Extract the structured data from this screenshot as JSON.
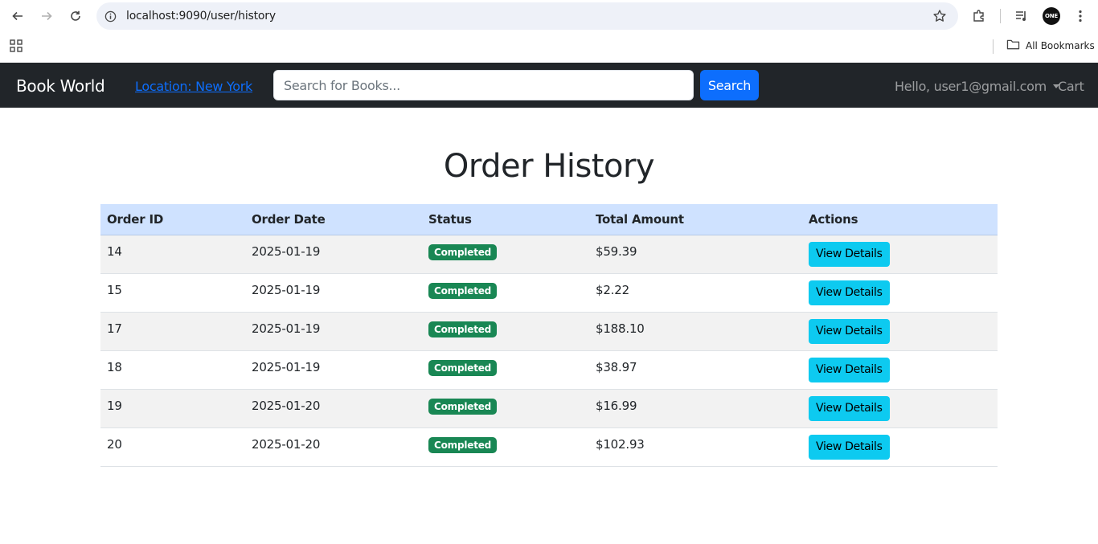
{
  "browser": {
    "url": "localhost:9090/user/history",
    "bookmarks_label": "All Bookmarks",
    "profile_badge": "ONE"
  },
  "navbar": {
    "brand": "Book World",
    "location": "Location: New York",
    "search_placeholder": "Search for Books...",
    "search_button": "Search",
    "user_greeting": "Hello, user1@gmail.com",
    "cart": "Cart"
  },
  "page": {
    "title": "Order History"
  },
  "table": {
    "headers": [
      "Order ID",
      "Order Date",
      "Status",
      "Total Amount",
      "Actions"
    ],
    "rows": [
      {
        "id": "14",
        "date": "2025-01-19",
        "status": "Completed",
        "total": "$59.39",
        "action": "View Details"
      },
      {
        "id": "15",
        "date": "2025-01-19",
        "status": "Completed",
        "total": "$2.22",
        "action": "View Details"
      },
      {
        "id": "17",
        "date": "2025-01-19",
        "status": "Completed",
        "total": "$188.10",
        "action": "View Details"
      },
      {
        "id": "18",
        "date": "2025-01-19",
        "status": "Completed",
        "total": "$38.97",
        "action": "View Details"
      },
      {
        "id": "19",
        "date": "2025-01-20",
        "status": "Completed",
        "total": "$16.99",
        "action": "View Details"
      },
      {
        "id": "20",
        "date": "2025-01-20",
        "status": "Completed",
        "total": "$102.93",
        "action": "View Details"
      }
    ]
  },
  "colors": {
    "navbar_bg": "#212529",
    "primary": "#0d6efd",
    "info": "#0dcaf0",
    "success": "#198754",
    "table_header_bg": "#cfe2ff"
  }
}
